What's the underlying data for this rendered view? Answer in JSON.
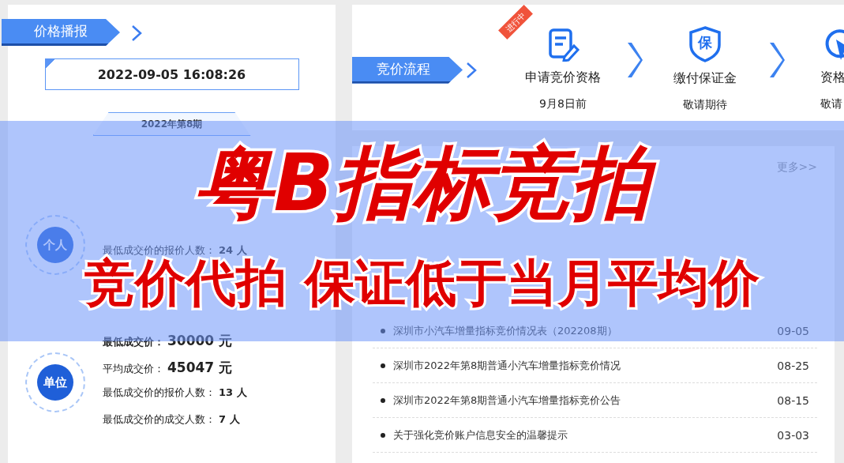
{
  "price_panel": {
    "title": "价格播报",
    "datetime": "2022-09-05 16:08:26",
    "period": "2022年第8期",
    "groups": [
      {
        "badge": "个人",
        "stats": [
          {
            "label": "最低成交价的报价人数：",
            "value": "24 人",
            "kind": "count",
            "emphasis": false
          }
        ]
      },
      {
        "badge": "单位",
        "stats": [
          {
            "label": "最低成交价：",
            "value": "30000 元",
            "kind": "price",
            "emphasis": true
          },
          {
            "label": "平均成交价：",
            "value": "45047 元",
            "kind": "price",
            "emphasis": false
          },
          {
            "label": "最低成交价的报价人数：",
            "value": "13 人",
            "kind": "count",
            "emphasis": false
          },
          {
            "label": "最低成交价的成交人数：",
            "value": "7 人",
            "kind": "count",
            "emphasis": false
          }
        ]
      }
    ]
  },
  "process": {
    "title": "竞价流程",
    "steps": [
      {
        "tag": "进行中",
        "kind": "form",
        "title": "申请竞价资格",
        "date": "9月8日前"
      },
      {
        "kind": "shield",
        "icon_text": "保",
        "title": "缴付保证金",
        "date": "敬请期待"
      },
      {
        "kind": "cursor",
        "title": "资格",
        "date": "敬请"
      }
    ]
  },
  "news": {
    "more": "更多>>",
    "items": [
      {
        "title": "深圳市小汽车增量指标竞价情况表（202208期）",
        "date": "09-05"
      },
      {
        "title": "深圳市2022年第8期普通小汽车增量指标竞价情况",
        "date": "08-25"
      },
      {
        "title": "深圳市2022年第8期普通小汽车增量指标竞价公告",
        "date": "08-15"
      },
      {
        "title": "关于强化竞价账户信息安全的温馨提示",
        "date": "03-03"
      }
    ]
  },
  "banner": {
    "headline": "粤B指标竞拍",
    "subline": "竞价代拍 保证低于当月平均价"
  }
}
